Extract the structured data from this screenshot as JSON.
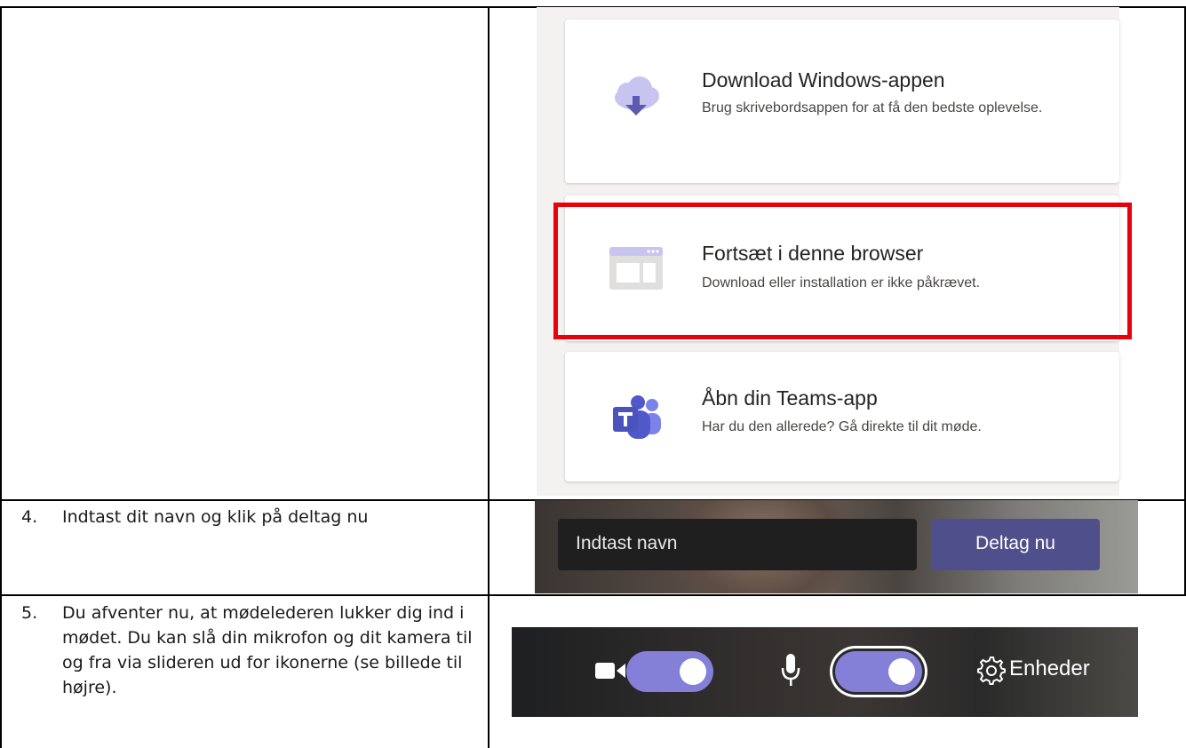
{
  "teams_options": {
    "download": {
      "title": "Download Windows-appen",
      "desc": "Brug skrivebordsappen for at få den bedste oplevelse.",
      "icon": "cloud-download-icon"
    },
    "browser": {
      "title": "Fortsæt i denne browser",
      "desc": "Download eller installation er ikke påkrævet.",
      "icon": "browser-window-icon"
    },
    "teams_app": {
      "title": "Åbn din Teams-app",
      "desc": "Har du den allerede? Gå direkte til dit møde.",
      "icon": "teams-logo-icon"
    },
    "highlight_color": "#e8000b"
  },
  "steps": [
    {
      "num": "4.",
      "text": "Indtast dit navn og klik på deltag nu"
    },
    {
      "num": "5.",
      "text": "Du afventer nu, at mødelederen lukker dig ind i mødet. Du kan slå din mikrofon og dit kamera til og fra via slideren ud for ikonerne (se billede til højre)."
    }
  ],
  "join": {
    "name_placeholder": "Indtast navn",
    "join_label": "Deltag nu",
    "button_color": "#4f4f8c"
  },
  "devices": {
    "camera_icon": "camera-icon",
    "camera_on": true,
    "mic_icon": "microphone-icon",
    "mic_on": true,
    "settings_icon": "gear-icon",
    "devices_label": "Enheder",
    "toggle_color": "#8480d8"
  }
}
